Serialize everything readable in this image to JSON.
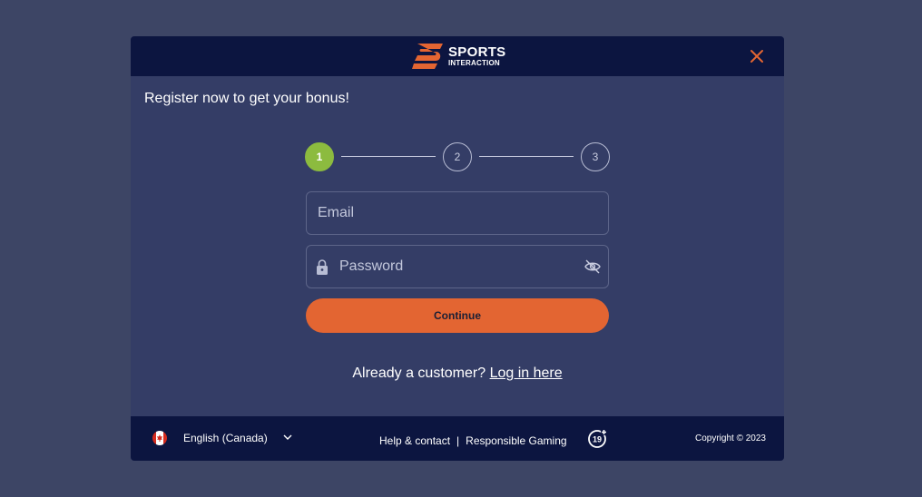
{
  "brand": {
    "name_line1": "SPORTS",
    "name_line2": "INTERACTION",
    "accent_color": "#e36532"
  },
  "header": {
    "close_icon": "close-icon"
  },
  "intro_text": "Register now to get your bonus!",
  "stepper": {
    "steps": [
      "1",
      "2",
      "3"
    ],
    "active_step": 1,
    "active_color": "#8cbb3f"
  },
  "form": {
    "email_placeholder": "Email",
    "email_value": "",
    "password_placeholder": "Password",
    "password_value": "",
    "continue_label": "Continue"
  },
  "login_prompt": {
    "text": "Already a customer?",
    "link": "Log in here"
  },
  "footer": {
    "language": "English (Canada)",
    "help_link": "Help & contact",
    "separator": "|",
    "responsible_link": "Responsible Gaming",
    "age_badge": "19+",
    "copyright": "Copyright © 2023"
  }
}
